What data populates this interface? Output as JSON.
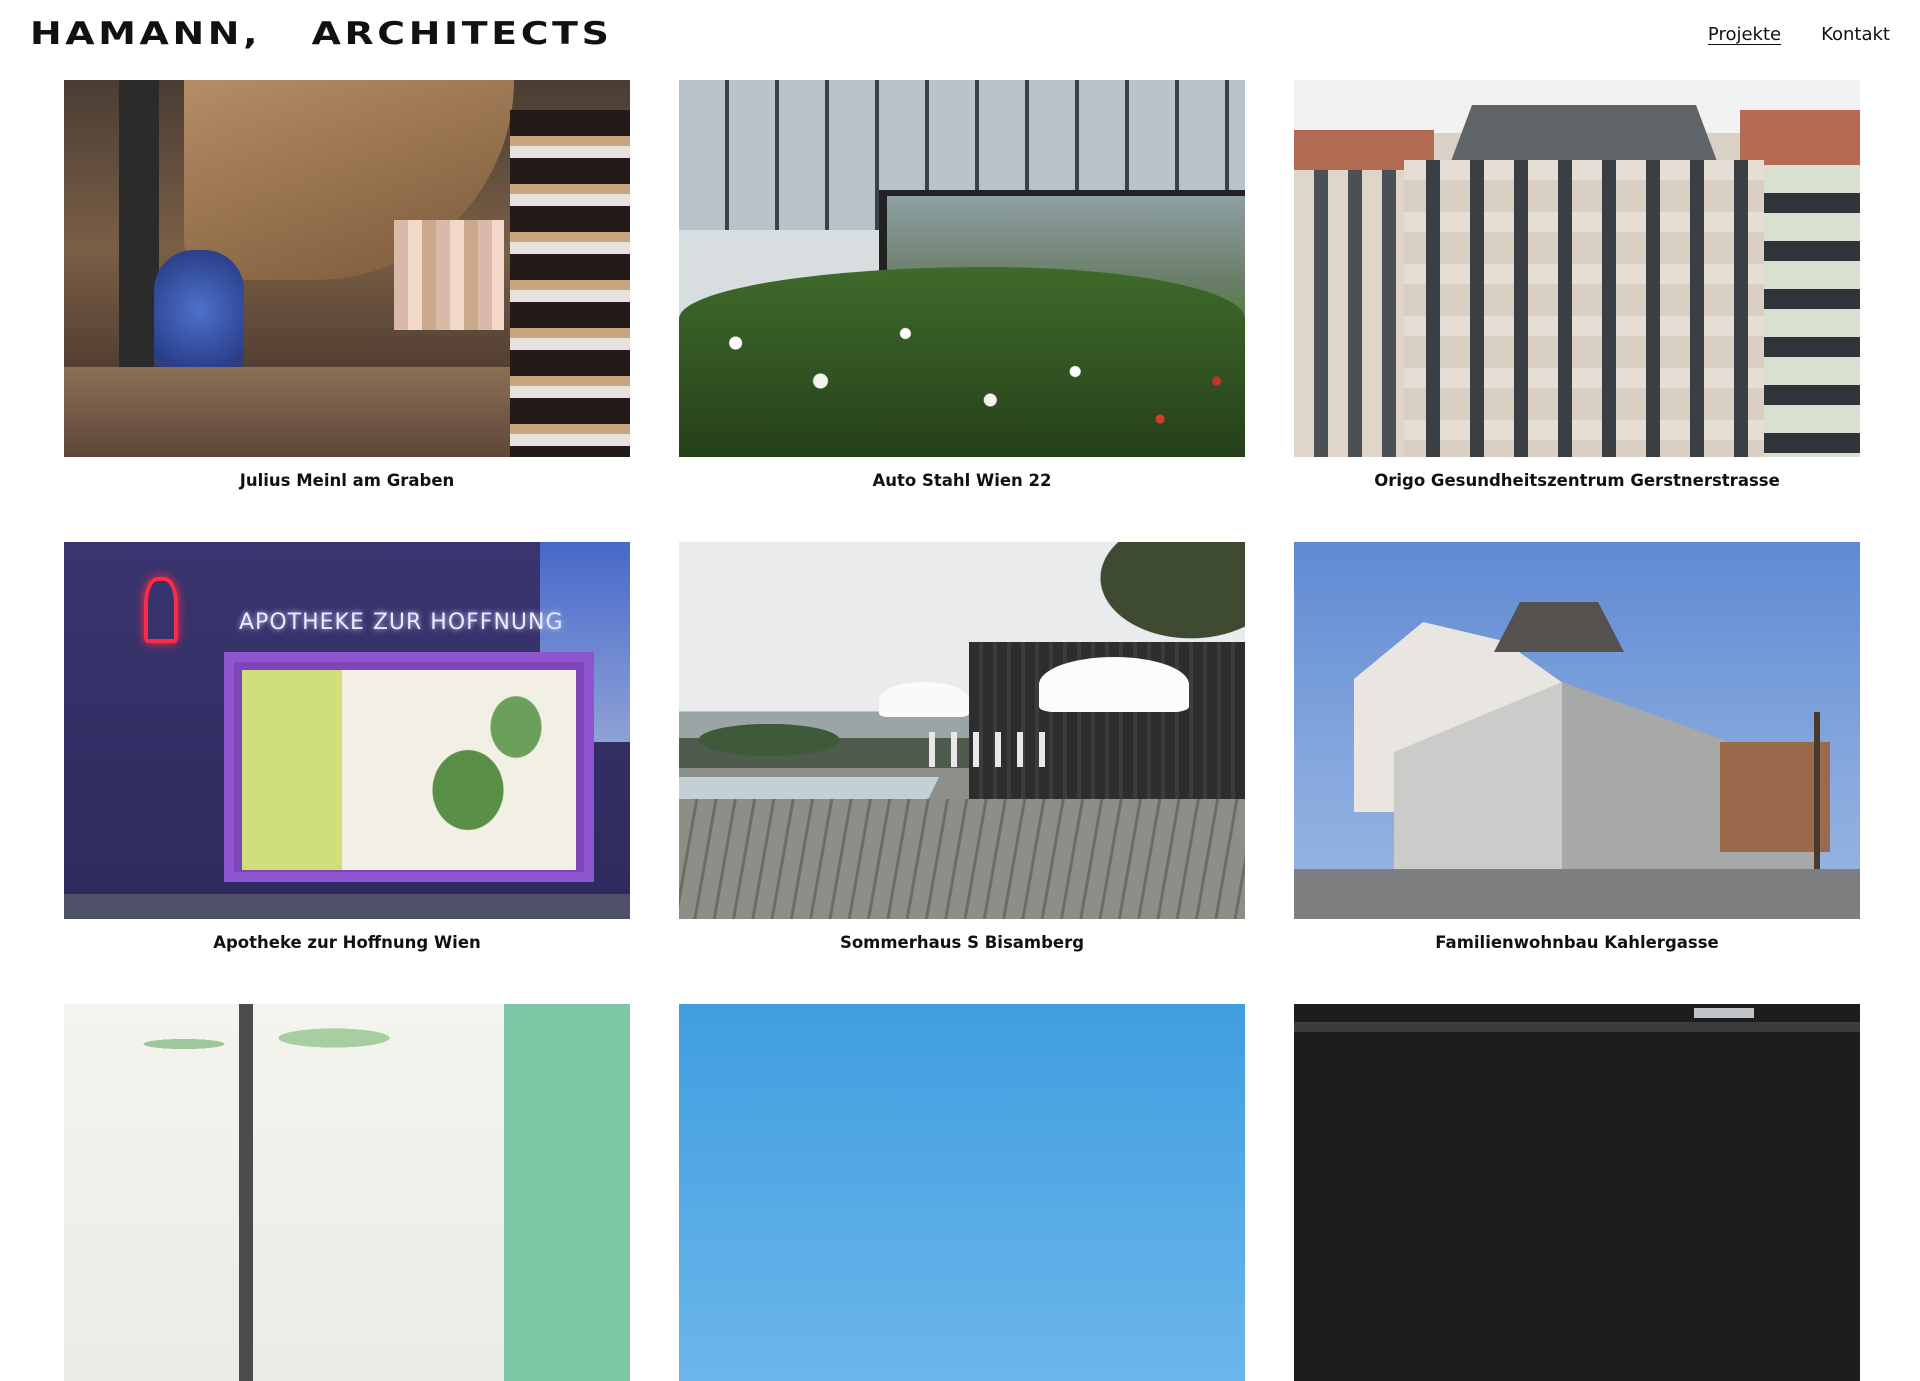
{
  "header": {
    "logo": "HAMANN,   ARCHITECTS",
    "nav": [
      {
        "label": "Projekte",
        "active": true
      },
      {
        "label": "Kontakt",
        "active": false
      }
    ]
  },
  "projects": [
    {
      "title": "Julius Meinl am Graben",
      "image": "store-interior-photo"
    },
    {
      "title": "Auto Stahl Wien 22",
      "image": "glass-facade-flowers-photo"
    },
    {
      "title": "Origo Gesundheitszentrum Gerstnerstrasse",
      "image": "historic-building-facade-photo"
    },
    {
      "title": "Apotheke zur Hoffnung Wien",
      "image": "pharmacy-storefront-photo",
      "sign_text": "APOTHEKE ZUR HOFFNUNG"
    },
    {
      "title": "Sommerhaus S Bisamberg",
      "image": "wooden-deck-pool-photo"
    },
    {
      "title": "Familienwohnbau Kahlergasse",
      "image": "white-residential-building-photo"
    },
    {
      "title": "",
      "image": "interior-green-ceiling-photo"
    },
    {
      "title": "",
      "image": "blue-sky-photo"
    },
    {
      "title": "",
      "image": "dark-interior-photo"
    }
  ]
}
